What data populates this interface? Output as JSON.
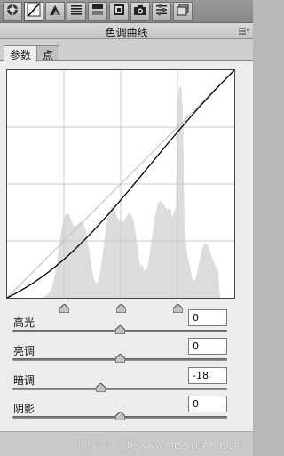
{
  "toolbar": {
    "tools": [
      {
        "icon": "aperture-icon"
      },
      {
        "icon": "curves-icon"
      },
      {
        "icon": "triangle-icon"
      },
      {
        "icon": "lines-icon"
      },
      {
        "icon": "split-icon"
      },
      {
        "icon": "lens-icon"
      },
      {
        "icon": "camera-icon"
      },
      {
        "icon": "sliders-icon"
      },
      {
        "icon": "presets-icon"
      }
    ],
    "active_index": 1
  },
  "panel": {
    "title": "色调曲线",
    "tabs": [
      {
        "label": "参数",
        "active": true
      },
      {
        "label": "点",
        "active": false
      }
    ]
  },
  "adjustments": [
    {
      "label": "高光",
      "value": "0",
      "slider_pct": 50
    },
    {
      "label": "亮调",
      "value": "0",
      "slider_pct": 50
    },
    {
      "label": "暗调",
      "value": "-18",
      "slider_pct": 41
    },
    {
      "label": "阴影",
      "value": "0",
      "slider_pct": 50
    }
  ],
  "split_points_pct": [
    25,
    50,
    75
  ],
  "watermark": "思缘设计论坛 www.MISSYUAN.COM",
  "colors": {
    "histogram": "#dcdcdc",
    "curve": "#000000",
    "grid": "#c8c8c8"
  }
}
